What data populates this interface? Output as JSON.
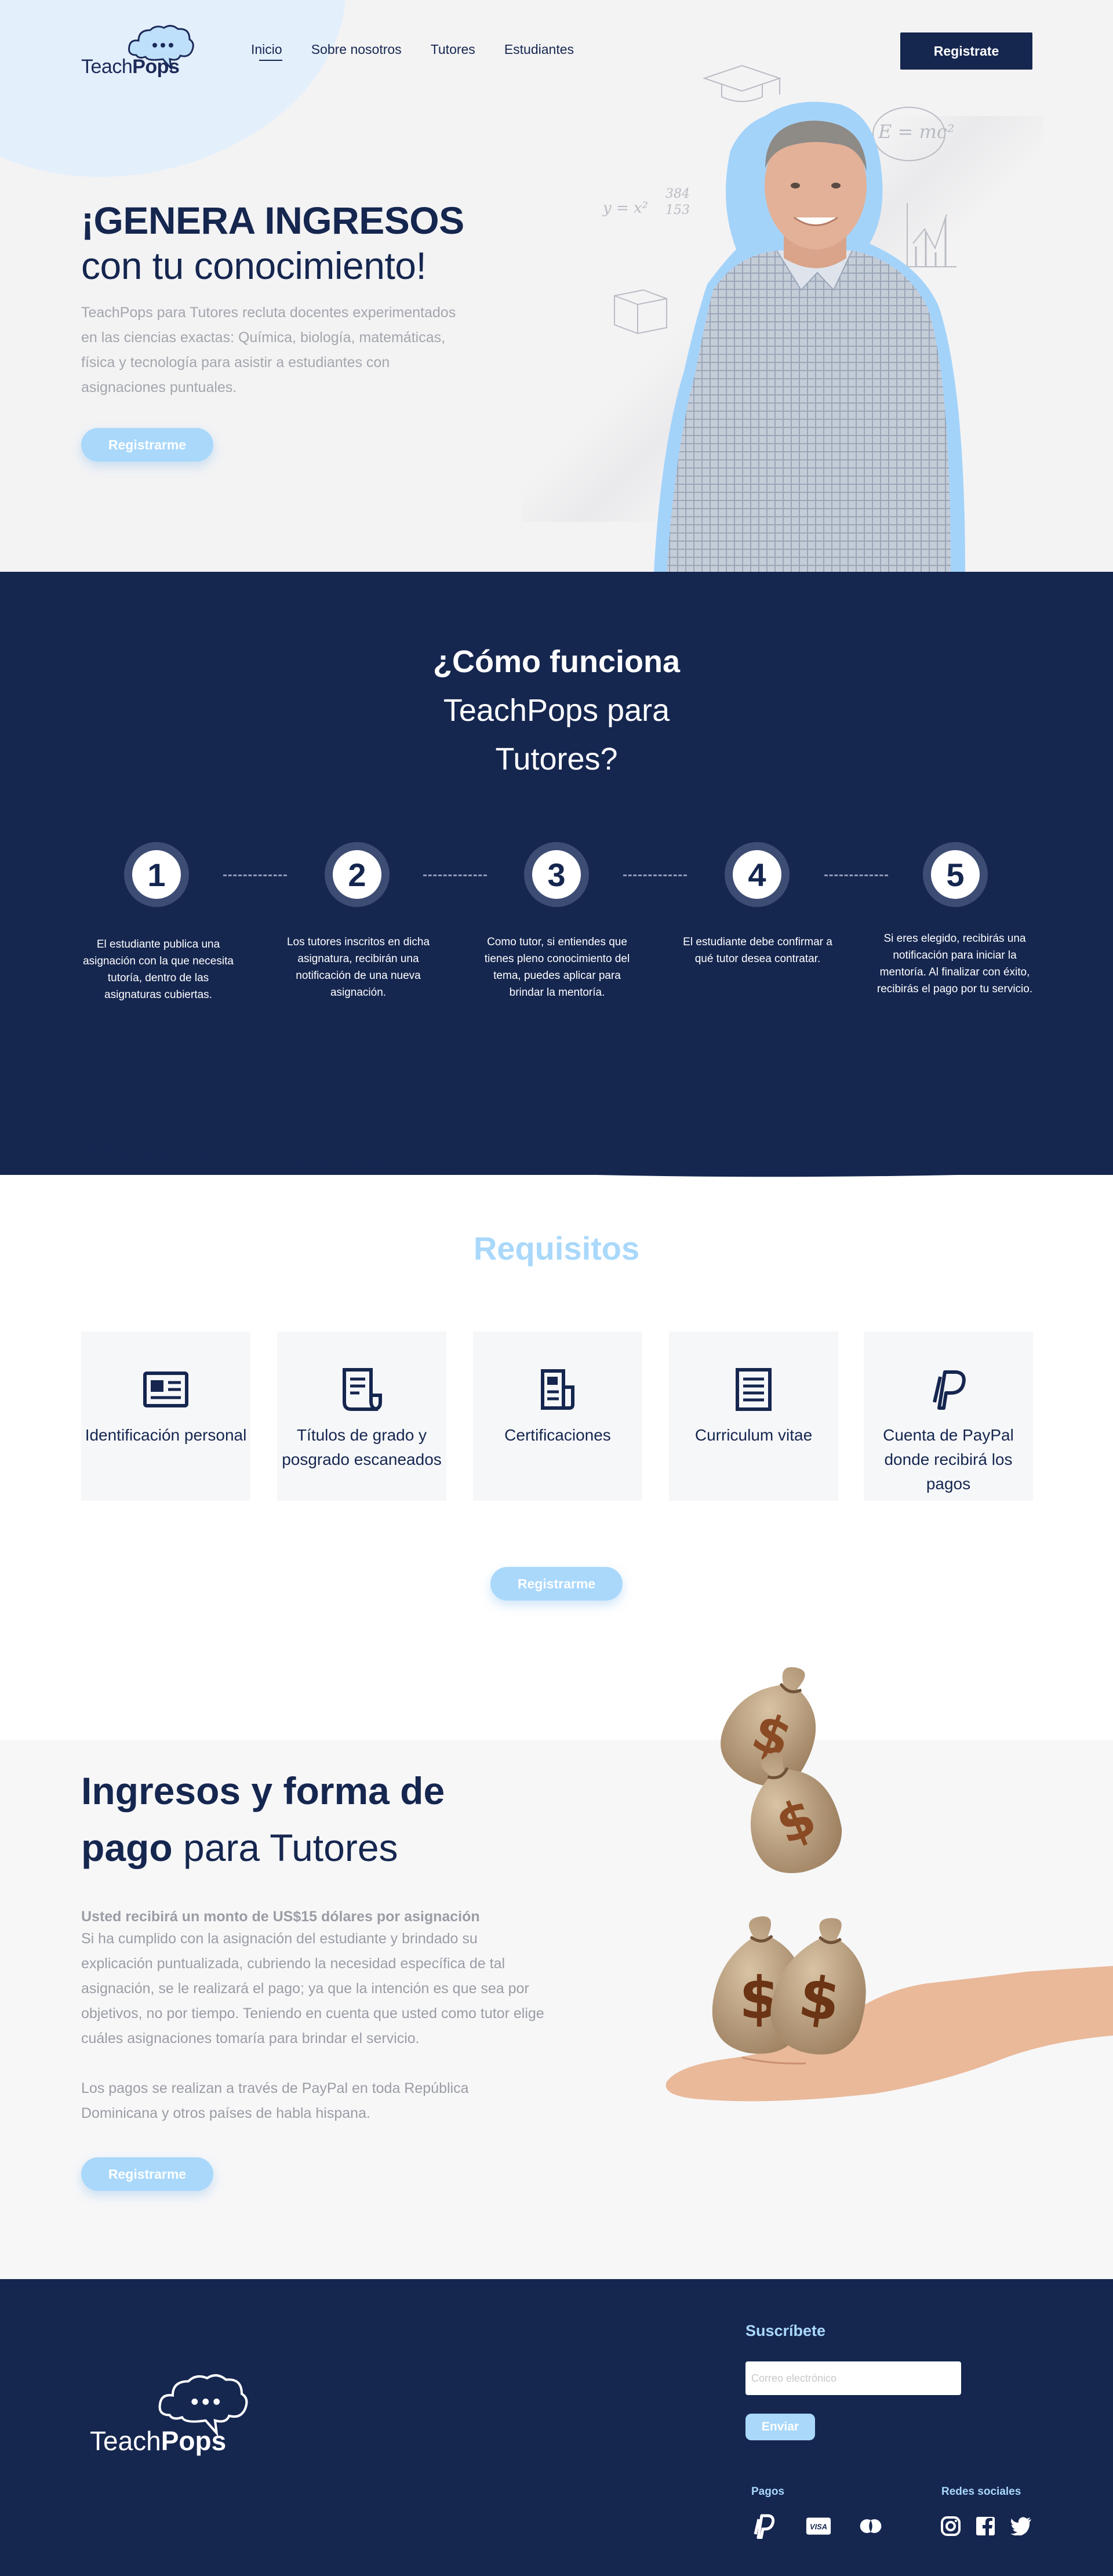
{
  "brand": {
    "name_light": "Teach",
    "name_bold": "Pops",
    "logo_icon": "cloud-chat-icon"
  },
  "nav": {
    "items": [
      "Inicio",
      "Sobre nosotros",
      "Tutores",
      "Estudiantes"
    ],
    "active": "Inicio",
    "cta": "Registrate"
  },
  "hero": {
    "title_bold": "¡GENERA INGRESOS",
    "title_regular": "con tu conocimiento!",
    "description": "TeachPops para Tutores recluta docentes experimentados en las ciencias exactas: Química, biología, matemáticas, física y tecnología para asistir a estudiantes con asignaciones puntuales.",
    "button": "Registrarme",
    "doodles": [
      "E = mc²",
      "y = x²",
      "384",
      "153"
    ]
  },
  "how_it_works": {
    "title_line1": "¿Cómo funciona",
    "title_line2": "TeachPops para",
    "title_line3": "Tutores?",
    "steps": [
      {
        "number": "1",
        "text": "El estudiante publica una asignación con la que necesita tutoría, dentro de las asignaturas cubiertas."
      },
      {
        "number": "2",
        "text": "Los tutores inscritos en dicha asignatura, recibirán una notificación de una nueva asignación."
      },
      {
        "number": "3",
        "text": "Como tutor, si entiendes que tienes pleno conocimiento del tema, puedes aplicar para brindar la mentoría."
      },
      {
        "number": "4",
        "text": "El estudiante debe confirmar a qué tutor desea contratar."
      },
      {
        "number": "5",
        "text": "Si eres elegido, recibirás una notificación para iniciar la mentoría. Al finalizar con éxito, recibirás el pago por tu servicio."
      }
    ]
  },
  "requirements": {
    "title": "Requisitos",
    "items": [
      {
        "label": "Identificación personal",
        "icon": "id-card-icon"
      },
      {
        "label": "Títulos de grado y posgrado escaneados",
        "icon": "document-icon"
      },
      {
        "label": "Certificaciones",
        "icon": "certificate-icon"
      },
      {
        "label": "Curriculum vitae",
        "icon": "resume-icon"
      },
      {
        "label": "Cuenta de PayPal donde recibirá los pagos",
        "icon": "paypal-icon"
      }
    ],
    "button": "Registrarme"
  },
  "income": {
    "title_line1": "Ingresos y forma de",
    "title_line2_bold": "pago",
    "title_line2_rest": " para Tutores",
    "lead": "Usted recibirá un monto de US$15 dólares por asignación",
    "body": "Si ha cumplido con la asignación del estudiante y brindado su explicación puntualizada, cubriendo la necesidad específica de tal asignación, se le realizará el pago; ya que la intención es que sea por objetivos, no por tiempo. Teniendo en cuenta que usted como tutor elige cuáles asignaciones tomaría para brindar el servicio.",
    "body2": "Los pagos se realizan a través de PayPal en toda República Dominicana y otros países de habla hispana.",
    "button": "Registrarme"
  },
  "footer": {
    "subscribe_title": "Suscríbete",
    "email_placeholder": "Correo electrónico",
    "send_button": "Enviar",
    "payments_label": "Pagos",
    "social_label": "Redes sociales",
    "payment_icons": [
      "paypal-icon",
      "visa-icon",
      "mastercard-icon"
    ],
    "social_icons": [
      "instagram-icon",
      "facebook-icon",
      "twitter-icon"
    ]
  },
  "colors": {
    "navy": "#15264f",
    "light_blue": "#a9d8fb",
    "gray_text": "#a3a6ad",
    "card_bg": "#f6f7f9"
  }
}
